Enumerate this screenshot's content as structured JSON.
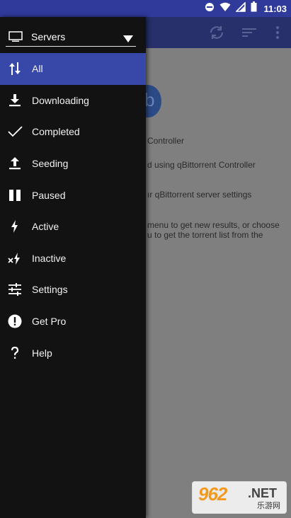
{
  "status_bar": {
    "time": "11:03"
  },
  "background_app": {
    "lines": [
      "Controller",
      "d using qBittorrent Controller",
      "ır qBittorrent server settings",
      "menu to get new results, or choose",
      "u to get the torrent list from the"
    ]
  },
  "drawer": {
    "server_label": "Servers",
    "items": [
      {
        "label": "All",
        "icon": "sort-arrows-icon",
        "active": true
      },
      {
        "label": "Downloading",
        "icon": "download-icon"
      },
      {
        "label": "Completed",
        "icon": "check-icon"
      },
      {
        "label": "Seeding",
        "icon": "upload-icon"
      },
      {
        "label": "Paused",
        "icon": "pause-icon"
      },
      {
        "label": "Active",
        "icon": "bolt-icon"
      },
      {
        "label": "Inactive",
        "icon": "bolt-off-icon"
      },
      {
        "label": "Settings",
        "icon": "sliders-icon"
      },
      {
        "label": "Get Pro",
        "icon": "alert-icon"
      },
      {
        "label": "Help",
        "icon": "help-icon"
      }
    ]
  },
  "watermark": {
    "main": "962",
    "suffix": ".NET",
    "sub": "乐游网"
  },
  "colors": {
    "accent": "#3748a8",
    "status_bar": "#2f3a9b",
    "drawer_bg": "#121212"
  }
}
